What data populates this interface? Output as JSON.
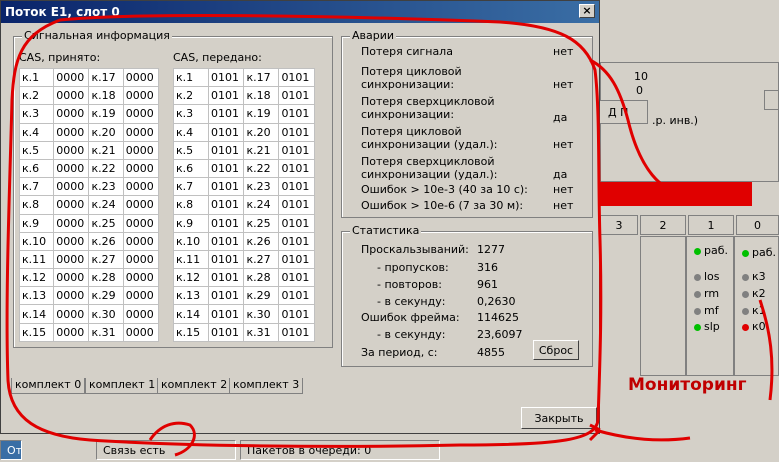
{
  "window": {
    "title": "Поток E1, слот 0",
    "close_glyph": "×"
  },
  "signal": {
    "legend": "Сигнальная информация",
    "received_title": "CAS, принято:",
    "sent_title": "CAS, передано:",
    "received_rows": [
      [
        "к.1",
        "0000",
        "к.17",
        "0000"
      ],
      [
        "к.2",
        "0000",
        "к.18",
        "0000"
      ],
      [
        "к.3",
        "0000",
        "к.19",
        "0000"
      ],
      [
        "к.4",
        "0000",
        "к.20",
        "0000"
      ],
      [
        "к.5",
        "0000",
        "к.21",
        "0000"
      ],
      [
        "к.6",
        "0000",
        "к.22",
        "0000"
      ],
      [
        "к.7",
        "0000",
        "к.23",
        "0000"
      ],
      [
        "к.8",
        "0000",
        "к.24",
        "0000"
      ],
      [
        "к.9",
        "0000",
        "к.25",
        "0000"
      ],
      [
        "к.10",
        "0000",
        "к.26",
        "0000"
      ],
      [
        "к.11",
        "0000",
        "к.27",
        "0000"
      ],
      [
        "к.12",
        "0000",
        "к.28",
        "0000"
      ],
      [
        "к.13",
        "0000",
        "к.29",
        "0000"
      ],
      [
        "к.14",
        "0000",
        "к.30",
        "0000"
      ],
      [
        "к.15",
        "0000",
        "к.31",
        "0000"
      ]
    ],
    "sent_rows": [
      [
        "к.1",
        "0101",
        "к.17",
        "0101"
      ],
      [
        "к.2",
        "0101",
        "к.18",
        "0101"
      ],
      [
        "к.3",
        "0101",
        "к.19",
        "0101"
      ],
      [
        "к.4",
        "0101",
        "к.20",
        "0101"
      ],
      [
        "к.5",
        "0101",
        "к.21",
        "0101"
      ],
      [
        "к.6",
        "0101",
        "к.22",
        "0101"
      ],
      [
        "к.7",
        "0101",
        "к.23",
        "0101"
      ],
      [
        "к.8",
        "0101",
        "к.24",
        "0101"
      ],
      [
        "к.9",
        "0101",
        "к.25",
        "0101"
      ],
      [
        "к.10",
        "0101",
        "к.26",
        "0101"
      ],
      [
        "к.11",
        "0101",
        "к.27",
        "0101"
      ],
      [
        "к.12",
        "0101",
        "к.28",
        "0101"
      ],
      [
        "к.13",
        "0101",
        "к.29",
        "0101"
      ],
      [
        "к.14",
        "0101",
        "к.30",
        "0101"
      ],
      [
        "к.15",
        "0101",
        "к.31",
        "0101"
      ]
    ]
  },
  "alarms": {
    "legend": "Аварии",
    "items": [
      {
        "label": "Потеря сигнала",
        "value": "нет"
      },
      {
        "label": "Потеря цикловой\nсинхронизации:",
        "value": "нет"
      },
      {
        "label": "Потеря сверхцикловой\nсинхронизации:",
        "value": "да"
      },
      {
        "label": "Потеря цикловой\nсинхронизации (удал.):",
        "value": "нет"
      },
      {
        "label": "Потеря сверхцикловой\nсинхронизации (удал.):",
        "value": "да"
      },
      {
        "label": "Ошибок > 10е-3 (40 за 10 с):",
        "value": "нет"
      },
      {
        "label": "Ошибок > 10е-6 (7 за 30 м):",
        "value": "нет"
      }
    ]
  },
  "stats": {
    "legend": "Статистика",
    "slips_label": "Проскальзываний:",
    "slips_value": "1277",
    "skips_label": "- пропусков:",
    "skips_value": "316",
    "repeats_label": "- повторов:",
    "repeats_value": "961",
    "per_sec_label": "- в секунду:",
    "per_sec_value": "0,2630",
    "frame_err_label": "Ошибок фрейма:",
    "frame_err_value": "114625",
    "frame_per_sec_label": "- в секунду:",
    "frame_per_sec_value": "23,6097",
    "period_label": "За период, с:",
    "period_value": "4855",
    "reset_label": "Сброс"
  },
  "tabs": [
    "комплект 0",
    "комплект 1",
    "комплект 2",
    "комплект 3"
  ],
  "close_button": "Закрыть",
  "status": {
    "left": "От",
    "connection": "Связь есть",
    "queue": "Пакетов в очереди: 0"
  },
  "background": {
    "col_headers": [
      "3",
      "2",
      "1",
      "0"
    ],
    "right_frag_1": "10",
    "right_frag_2": "0",
    "right_frag_3": "Д П",
    "right_frag_4": ".р. инв.)",
    "col1_leds": [
      {
        "label": "раб.",
        "color": "#00c000"
      },
      {
        "label": "los",
        "color": "#808080"
      },
      {
        "label": "rm",
        "color": "#808080"
      },
      {
        "label": "mf",
        "color": "#808080"
      },
      {
        "label": "slp",
        "color": "#00c000"
      }
    ],
    "col0_leds": [
      {
        "label": "раб.",
        "color": "#00c000"
      },
      {
        "label": "к3",
        "color": "#808080"
      },
      {
        "label": "к2",
        "color": "#808080"
      },
      {
        "label": "к1",
        "color": "#808080"
      },
      {
        "label": "к0",
        "color": "#e00000"
      }
    ]
  },
  "annotation": {
    "text": "Мониторинг",
    "color": "#e00000"
  }
}
